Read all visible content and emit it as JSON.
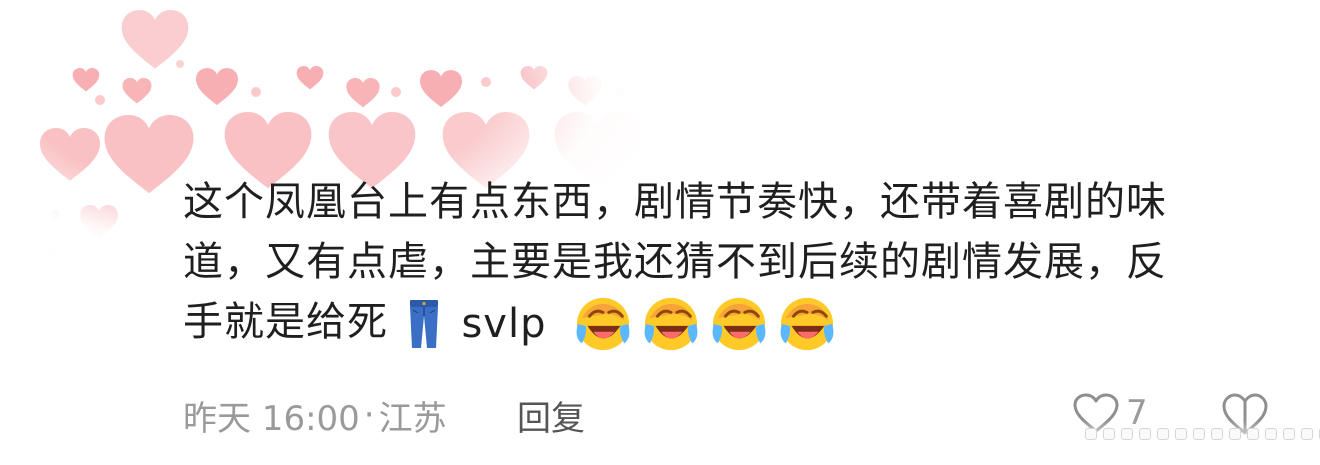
{
  "comment": {
    "line1": "这个凤凰台上有点东西，剧情节奏快，还带着喜剧的味",
    "line2": "道，又有点虐，主要是我还猜不到后续的剧情发展，反",
    "line3_text": "手就是给死",
    "line3_slang": "svlp",
    "emojis": [
      "jeans-emoji",
      "laugh-cry-emoji",
      "laugh-cry-emoji",
      "laugh-cry-emoji",
      "laugh-cry-emoji"
    ]
  },
  "meta": {
    "time": "昨天 16:00",
    "separator": "·",
    "location": "江苏",
    "reply_label": "回复"
  },
  "actions": {
    "like_icon": "heart-outline-icon",
    "like_count": "7",
    "dislike_icon": "dislike-icon"
  },
  "colors": {
    "text": "#1f1f1f",
    "meta": "#9a9a9a",
    "reply": "#555555",
    "heart_pink": "#f7a3a8"
  }
}
